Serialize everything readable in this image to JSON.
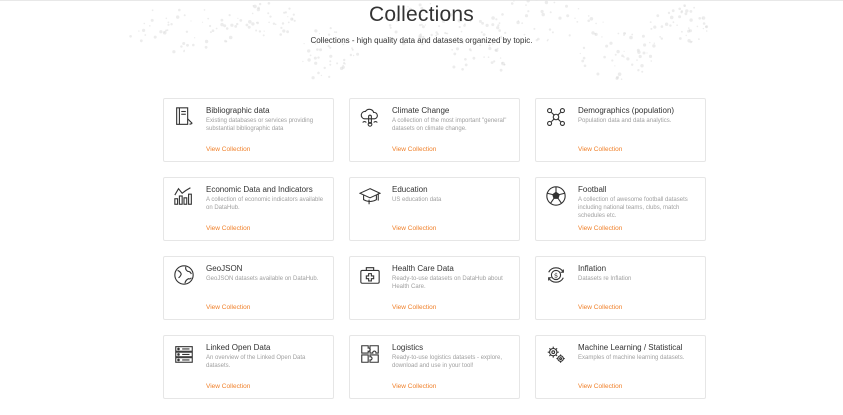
{
  "header": {
    "title": "Collections",
    "subtitle": "Collections - high quality data and datasets organized by topic."
  },
  "theme": {
    "link_color": "#f0812b",
    "border_color": "#e6e6e6"
  },
  "collections": [
    {
      "title": "Bibliographic data",
      "description": "Existing databases or services providing substantial bibliographic data",
      "link": "View Collection",
      "icon": "book-icon"
    },
    {
      "title": "Climate Change",
      "description": "A collection of the most important \"general\" datasets on climate change.",
      "link": "View Collection",
      "icon": "cloud-thermometer-icon"
    },
    {
      "title": "Demographics (population)",
      "description": "Population data and data analytics.",
      "link": "View Collection",
      "icon": "people-network-icon"
    },
    {
      "title": "Economic Data and Indicators",
      "description": "A collection of economic indicators available on DataHub.",
      "link": "View Collection",
      "icon": "chart-icon"
    },
    {
      "title": "Education",
      "description": "US education data",
      "link": "View Collection",
      "icon": "graduation-cap-icon"
    },
    {
      "title": "Football",
      "description": "A collection of awesome football datasets including national teams, clubs, match schedules etc.",
      "link": "View Collection",
      "icon": "football-icon"
    },
    {
      "title": "GeoJSON",
      "description": "GeoJSON datasets available on DataHub.",
      "link": "View Collection",
      "icon": "globe-icon"
    },
    {
      "title": "Health Care Data",
      "description": "Ready-to-use datasets on DataHub about Health Care.",
      "link": "View Collection",
      "icon": "medical-kit-icon"
    },
    {
      "title": "Inflation",
      "description": "Datasets re Inflation",
      "link": "View Collection",
      "icon": "dollar-cycle-icon"
    },
    {
      "title": "Linked Open Data",
      "description": "An overview of the Linked Open Data datasets.",
      "link": "View Collection",
      "icon": "server-icon"
    },
    {
      "title": "Logistics",
      "description": "Ready-to-use logistics datasets - explore, download and use in your tool!",
      "link": "View Collection",
      "icon": "puzzle-icon"
    },
    {
      "title": "Machine Learning / Statistical",
      "description": "Examples of machine learning datasets.",
      "link": "View Collection",
      "icon": "gears-icon"
    }
  ]
}
